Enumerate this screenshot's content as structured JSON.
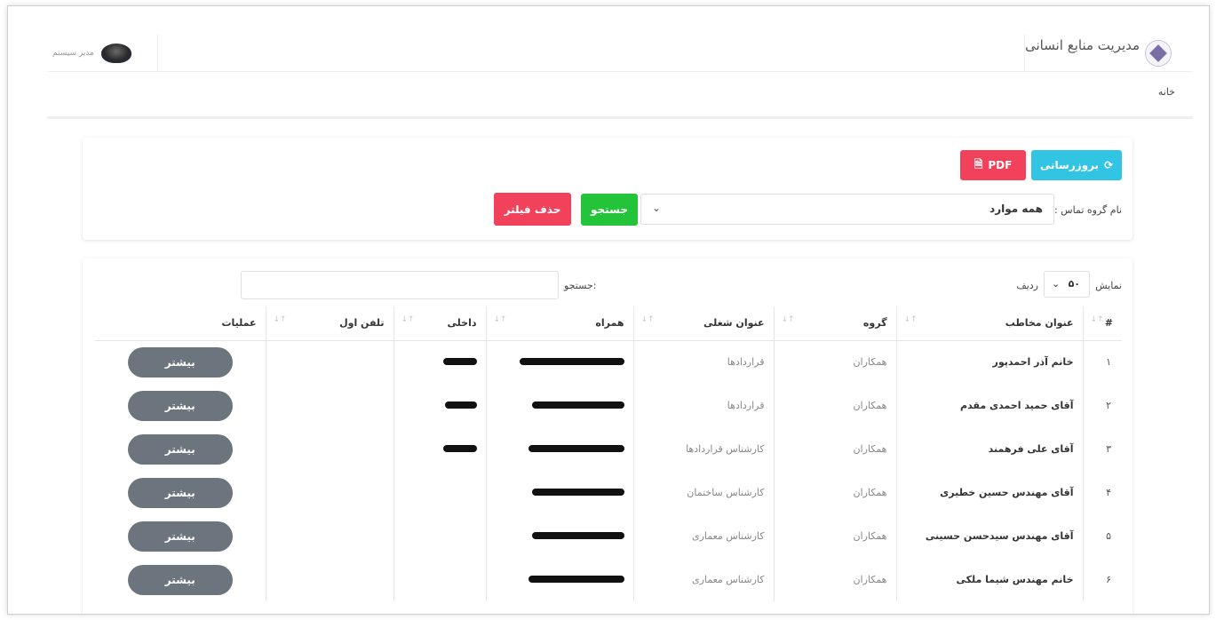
{
  "header": {
    "app_name": "مدیریت منابع انسانی",
    "user_role": "مدیر سیستم"
  },
  "breadcrumb": {
    "home": "خانه"
  },
  "toolbar": {
    "refresh_label": "بروزرسانی",
    "pdf_label": "PDF",
    "filter_label": "نام گروه تماس :",
    "filter_value": "همه موارد",
    "search_label": "جستجو",
    "clear_label": "حذف فیلتر"
  },
  "table_controls": {
    "show_label": "نمایش",
    "page_size": "۵۰",
    "rows_label": "ردیف",
    "search_label": "جستجو:"
  },
  "columns": [
    "#",
    "عنوان مخاطب",
    "گروه",
    "عنوان شغلی",
    "همراه",
    "داخلی",
    "تلفن اول",
    "عملیات"
  ],
  "rows": [
    {
      "num": "۱",
      "name": "خانم آذر احمدپور",
      "group": "همکاران",
      "job": "قراردادها",
      "mobile_w": 118,
      "ext_w": 38,
      "more": "بیشتر"
    },
    {
      "num": "۲",
      "name": "آقای حمید احمدی مقدم",
      "group": "همکاران",
      "job": "قراردادها",
      "mobile_w": 104,
      "ext_w": 36,
      "more": "بیشتر"
    },
    {
      "num": "۳",
      "name": "آقای علی فرهمند",
      "group": "همکاران",
      "job": "کارشناس قراردادها",
      "mobile_w": 108,
      "ext_w": 38,
      "more": "بیشتر"
    },
    {
      "num": "۴",
      "name": "آقای مهندس حسین خطیری",
      "group": "همکاران",
      "job": "کارشناس ساختمان",
      "mobile_w": 104,
      "ext_w": 0,
      "more": "بیشتر"
    },
    {
      "num": "۵",
      "name": "آقای مهندس سیدحسن حسینی",
      "group": "همکاران",
      "job": "کارشناس معماری",
      "mobile_w": 104,
      "ext_w": 0,
      "more": "بیشتر"
    },
    {
      "num": "۶",
      "name": "خانم مهندس شیما ملکی",
      "group": "همکاران",
      "job": "کارشناس معماری",
      "mobile_w": 108,
      "ext_w": 0,
      "more": "بیشتر"
    }
  ],
  "colors": {
    "refresh": "#32c5e3",
    "danger": "#f2415a",
    "success": "#23c43a",
    "secondary": "#6c757d"
  }
}
